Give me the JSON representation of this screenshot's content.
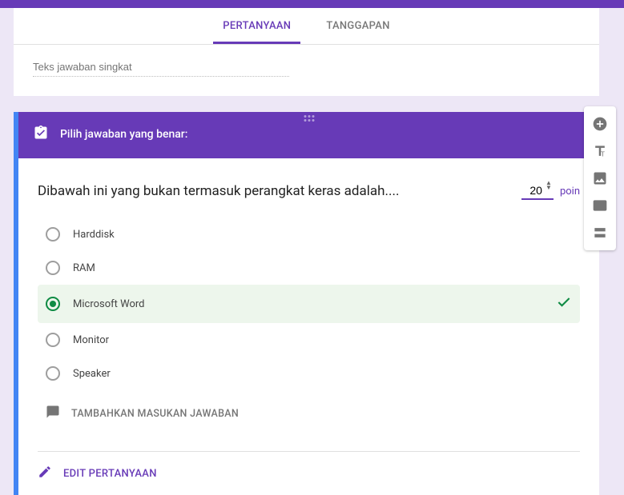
{
  "tabs": {
    "questions": "PERTANYAAN",
    "responses": "TANGGAPAN"
  },
  "short_answer": {
    "placeholder": "Teks jawaban singkat"
  },
  "answer_key": {
    "title": "Pilih jawaban yang benar:"
  },
  "question": {
    "text": "Dibawah ini yang bukan termasuk perangkat keras adalah....",
    "points_value": "20",
    "points_label": "poin",
    "options": [
      {
        "label": "Harddisk",
        "correct": false
      },
      {
        "label": "RAM",
        "correct": false
      },
      {
        "label": "Microsoft Word",
        "correct": true
      },
      {
        "label": "Monitor",
        "correct": false
      },
      {
        "label": "Speaker",
        "correct": false
      }
    ],
    "add_feedback": "TAMBAHKAN MASUKAN JAWABAN",
    "edit_label": "EDIT PERTANYAAN"
  },
  "toolbar": {
    "add": "add",
    "title": "title",
    "image": "image",
    "video": "video",
    "section": "section"
  }
}
